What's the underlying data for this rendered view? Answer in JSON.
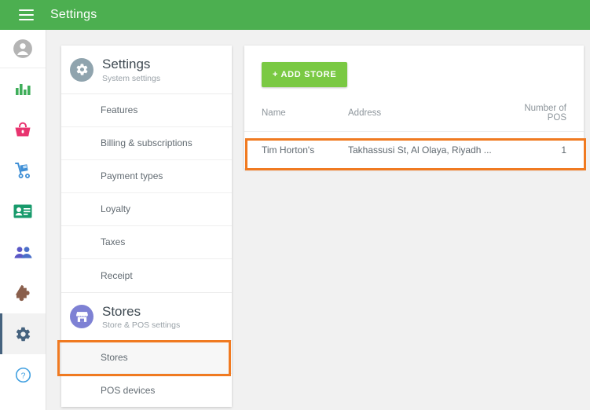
{
  "topbar": {
    "menu_icon": "hamburger-icon",
    "title": "Settings",
    "background_color": "#4caf50"
  },
  "rail": {
    "items": [
      {
        "icon": "user-avatar-icon",
        "color": "#b0b0b0",
        "active": false
      },
      {
        "icon": "bar-chart-icon",
        "color": "#3fae5a",
        "active": false
      },
      {
        "icon": "shopping-basket-icon",
        "color": "#e8346f",
        "active": false
      },
      {
        "icon": "inventory-cart-icon",
        "color": "#3f8fd6",
        "active": false
      },
      {
        "icon": "id-card-icon",
        "color": "#179a6b",
        "active": false
      },
      {
        "icon": "people-icon",
        "color": "#5a57c6",
        "active": false
      },
      {
        "icon": "puzzle-piece-icon",
        "color": "#8a5f4c",
        "active": false
      },
      {
        "icon": "gear-icon",
        "color": "#46637f",
        "active": true
      },
      {
        "icon": "help-circle-icon",
        "color": "#3f9fe0",
        "active": false
      }
    ],
    "active_indicator_color": "#46637f"
  },
  "settings_card": {
    "header": {
      "icon": "gear-icon",
      "icon_background": "#90a4ae",
      "title": "Settings",
      "subtitle": "System settings"
    },
    "items": [
      {
        "label": "Features"
      },
      {
        "label": "Billing & subscriptions"
      },
      {
        "label": "Payment types"
      },
      {
        "label": "Loyalty"
      },
      {
        "label": "Taxes"
      },
      {
        "label": "Receipt"
      }
    ]
  },
  "stores_card": {
    "header": {
      "icon": "store-icon",
      "icon_background": "#7e81d4",
      "title": "Stores",
      "subtitle": "Store & POS settings"
    },
    "items": [
      {
        "label": "Stores",
        "selected": true
      },
      {
        "label": "POS devices",
        "selected": false
      }
    ]
  },
  "content": {
    "add_store_label": "+ ADD STORE",
    "add_store_color": "#7ac943",
    "table": {
      "columns": [
        "Name",
        "Address",
        "Number of POS"
      ],
      "rows": [
        {
          "name": "Tim Horton's",
          "address": "Takhassusi St, Al Olaya, Riyadh ...",
          "pos_count": "1"
        }
      ]
    }
  },
  "annotations": {
    "highlight_color": "#f07a21",
    "stores_menu_highlight": "stores-menu-item",
    "store_row_highlight": "store-table-row"
  }
}
